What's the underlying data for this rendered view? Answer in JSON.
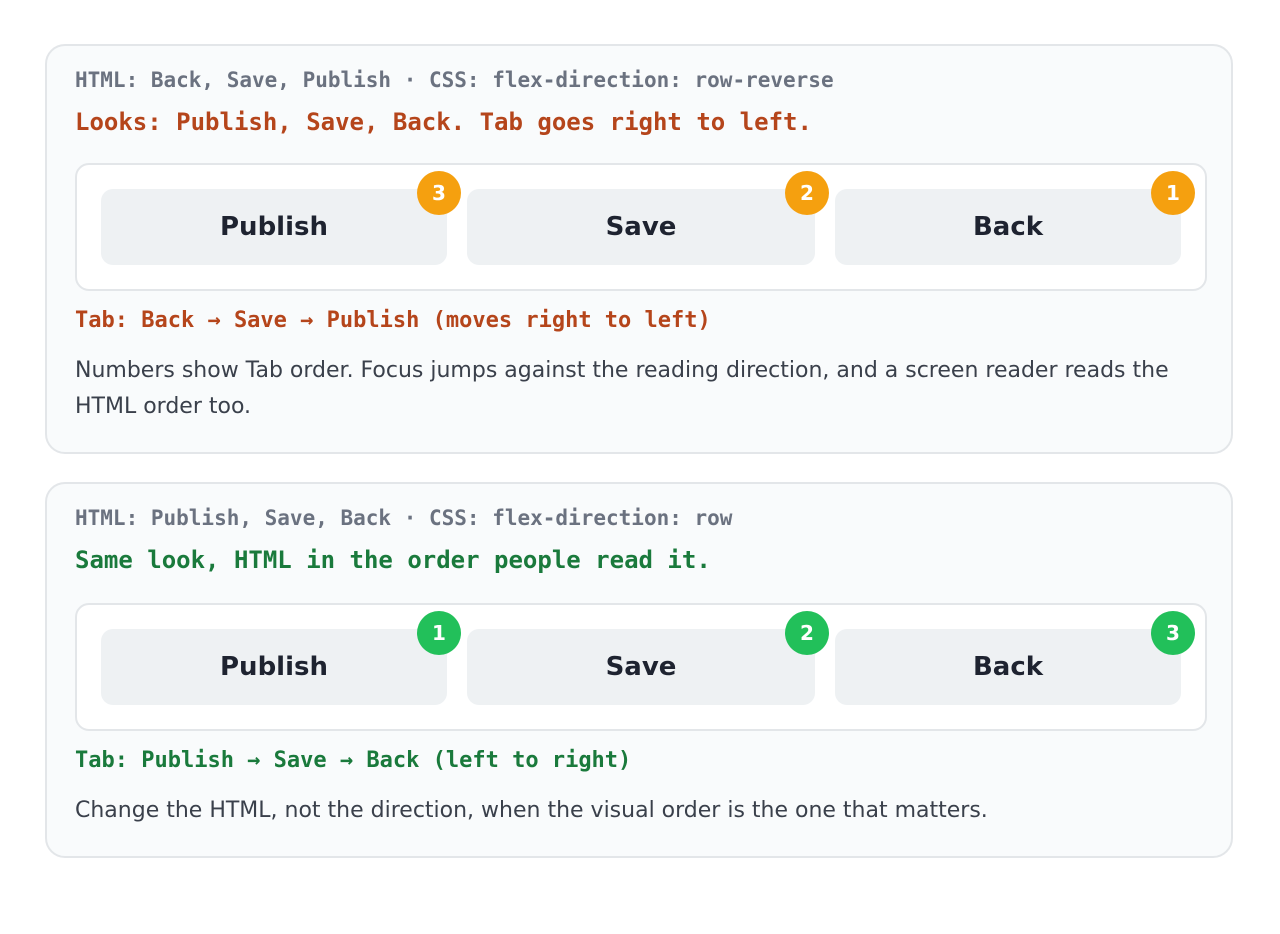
{
  "examples": [
    {
      "code": "HTML: Back, Save, Publish · CSS: flex-direction: row-reverse",
      "headline": "Looks: Publish, Save, Back. Tab goes right to left.",
      "accent": "#b5451b",
      "badge_color": "#f5a00f",
      "buttons": [
        {
          "label": "Publish",
          "tab_index": "3"
        },
        {
          "label": "Save",
          "tab_index": "2"
        },
        {
          "label": "Back",
          "tab_index": "1"
        }
      ],
      "tab_order": "Tab: Back → Save → Publish  (moves right to left)",
      "description": "Numbers show Tab order. Focus jumps against the reading direction, and a screen reader reads the HTML order too."
    },
    {
      "code": "HTML: Publish, Save, Back · CSS: flex-direction: row",
      "headline": "Same look, HTML in the order people read it.",
      "accent": "#1a7a3c",
      "badge_color": "#22c05a",
      "buttons": [
        {
          "label": "Publish",
          "tab_index": "1"
        },
        {
          "label": "Save",
          "tab_index": "2"
        },
        {
          "label": "Back",
          "tab_index": "3"
        }
      ],
      "tab_order": "Tab: Publish → Save → Back  (left to right)",
      "description": "Change the HTML, not the direction, when the visual order is the one that matters."
    }
  ]
}
